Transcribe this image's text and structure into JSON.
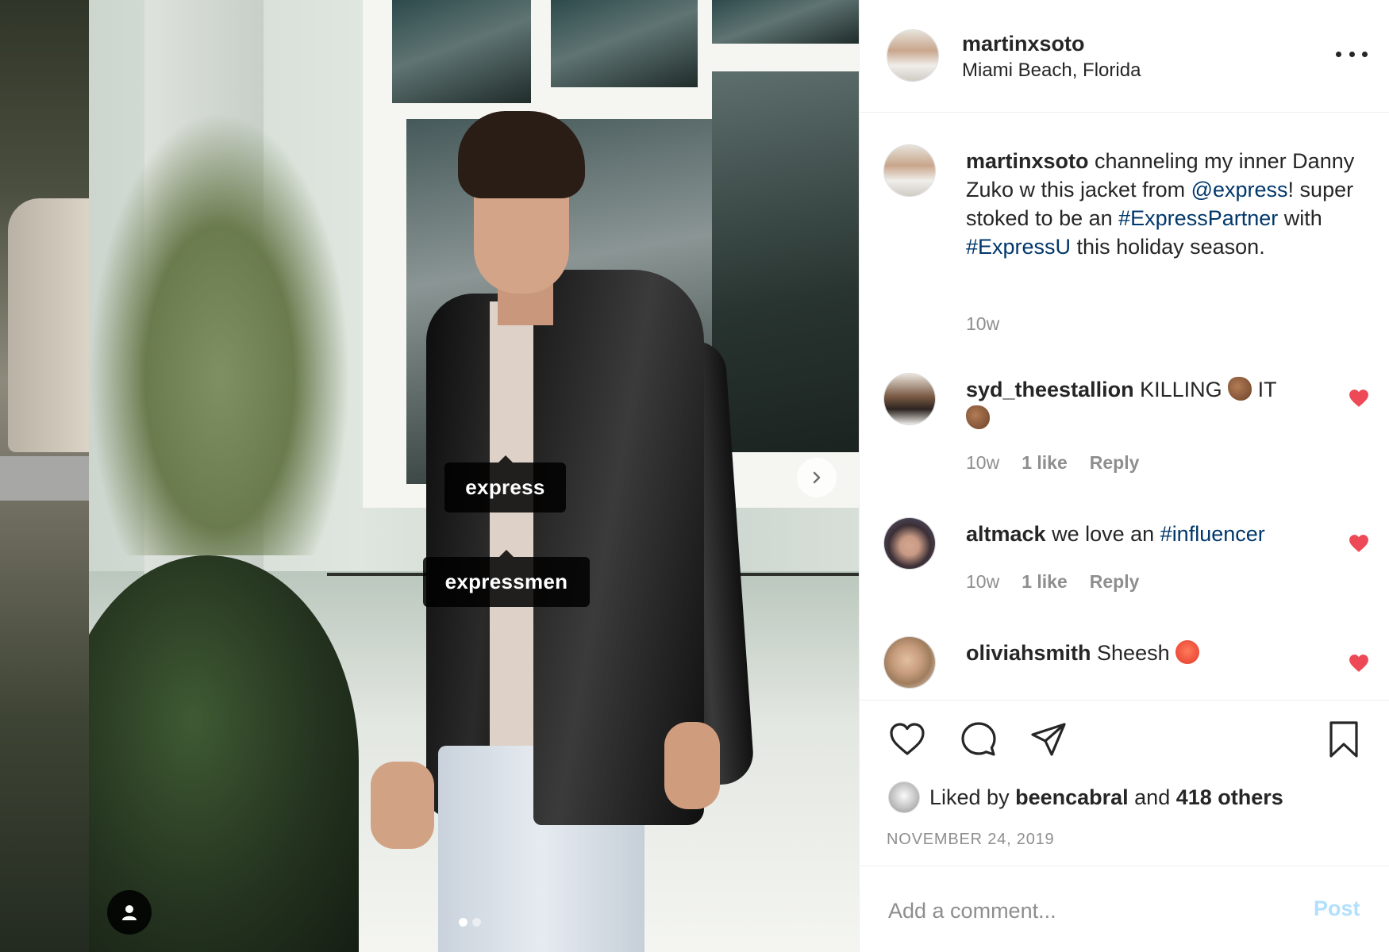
{
  "post": {
    "image_tags": [
      "express",
      "expressmen"
    ],
    "carousel": {
      "count": 2,
      "active": 0
    }
  },
  "header": {
    "username": "martinxsoto",
    "location": "Miami Beach, Florida"
  },
  "caption": {
    "username": "martinxsoto",
    "text_1": " channeling my inner Danny Zuko w this jacket from ",
    "mention": "@express",
    "text_2": "! super stoked to be an ",
    "hashtag_1": "#ExpressPartner",
    "text_3": " with ",
    "hashtag_2": "#ExpressU",
    "text_4": " this holiday season.",
    "time": "10w"
  },
  "comments": [
    {
      "username": "syd_theestallion",
      "text_1": " KILLING ",
      "text_2": " IT",
      "time": "10w",
      "likes": "1 like",
      "reply": "Reply"
    },
    {
      "username": "altmack",
      "text_1": " we love an ",
      "hashtag": "#influencer",
      "time": "10w",
      "likes": "1 like",
      "reply": "Reply"
    },
    {
      "username": "oliviahsmith",
      "text_1": " Sheesh "
    }
  ],
  "likes": {
    "prefix": "Liked by ",
    "user": "beencabral",
    "middle": " and ",
    "others": "418 others"
  },
  "date": "NOVEMBER 24, 2019",
  "add_comment": {
    "placeholder": "Add a comment...",
    "post_label": "Post"
  },
  "colors": {
    "link": "#00376b",
    "heart": "#ed4956",
    "muted": "#8e8e8e",
    "post_disabled": "#b2dffc"
  },
  "icons": [
    "user-tags-icon",
    "next-arrow-icon",
    "more-icon",
    "heart-icon",
    "comment-icon",
    "share-icon",
    "bookmark-icon"
  ]
}
